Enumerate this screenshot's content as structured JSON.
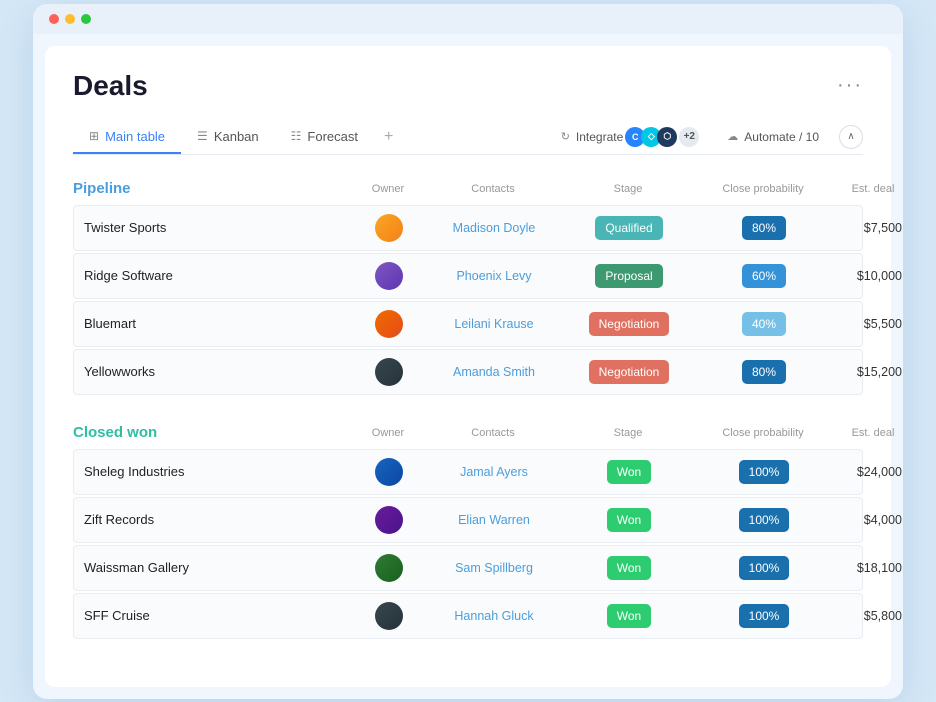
{
  "page": {
    "title": "Deals",
    "more_label": "···"
  },
  "tabs": [
    {
      "id": "main-table",
      "label": "Main table",
      "icon": "⊞",
      "active": true
    },
    {
      "id": "kanban",
      "label": "Kanban",
      "icon": "☰",
      "active": false
    },
    {
      "id": "forecast",
      "label": "Forecast",
      "icon": "☷",
      "active": false
    }
  ],
  "tab_add": "+",
  "toolbar": {
    "integrate_label": "Integrate",
    "automate_label": "Automate / 10",
    "icon_count": "+2"
  },
  "pipeline": {
    "title": "Pipeline",
    "columns": {
      "owner": "Owner",
      "contacts": "Contacts",
      "stage": "Stage",
      "close_probability": "Close probability",
      "est_deal": "Est. deal"
    },
    "rows": [
      {
        "name": "Twister Sports",
        "avatar_class": "avatar-1",
        "contact": "Madison Doyle",
        "stage": "Qualified",
        "stage_class": "stage-qualified",
        "probability": "80%",
        "prob_class": "prob-80",
        "deal": "$7,500"
      },
      {
        "name": "Ridge Software",
        "avatar_class": "avatar-2",
        "contact": "Phoenix Levy",
        "stage": "Proposal",
        "stage_class": "stage-proposal",
        "probability": "60%",
        "prob_class": "prob-60",
        "deal": "$10,000"
      },
      {
        "name": "Bluemart",
        "avatar_class": "avatar-3",
        "contact": "Leilani Krause",
        "stage": "Negotiation",
        "stage_class": "stage-negotiation",
        "probability": "40%",
        "prob_class": "prob-40",
        "deal": "$5,500"
      },
      {
        "name": "Yellowworks",
        "avatar_class": "avatar-4",
        "contact": "Amanda Smith",
        "stage": "Negotiation",
        "stage_class": "stage-negotiation",
        "probability": "80%",
        "prob_class": "prob-80",
        "deal": "$15,200"
      }
    ]
  },
  "closed_won": {
    "title": "Closed won",
    "columns": {
      "owner": "Owner",
      "contacts": "Contacts",
      "stage": "Stage",
      "close_probability": "Close probability",
      "est_deal": "Est. deal"
    },
    "rows": [
      {
        "name": "Sheleg Industries",
        "avatar_class": "avatar-5",
        "contact": "Jamal Ayers",
        "stage": "Won",
        "stage_class": "stage-won",
        "probability": "100%",
        "prob_class": "prob-100",
        "deal": "$24,000"
      },
      {
        "name": "Zift Records",
        "avatar_class": "avatar-6",
        "contact": "Elian Warren",
        "stage": "Won",
        "stage_class": "stage-won",
        "probability": "100%",
        "prob_class": "prob-100",
        "deal": "$4,000"
      },
      {
        "name": "Waissman Gallery",
        "avatar_class": "avatar-7",
        "contact": "Sam Spillberg",
        "stage": "Won",
        "stage_class": "stage-won",
        "probability": "100%",
        "prob_class": "prob-100",
        "deal": "$18,100"
      },
      {
        "name": "SFF Cruise",
        "avatar_class": "avatar-8",
        "contact": "Hannah Gluck",
        "stage": "Won",
        "stage_class": "stage-won",
        "probability": "100%",
        "prob_class": "prob-100",
        "deal": "$5,800"
      }
    ]
  }
}
